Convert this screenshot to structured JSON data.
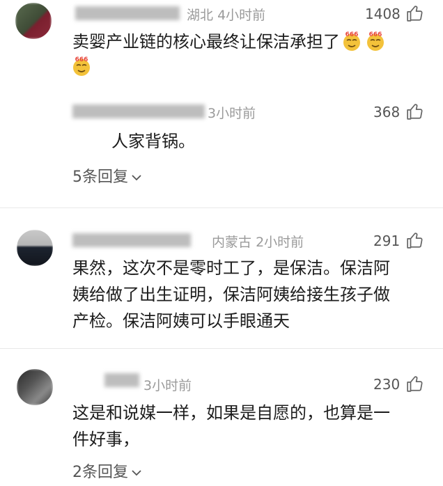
{
  "comments": [
    {
      "location": "湖北",
      "time": "4小时前",
      "likes": "1408",
      "text": "卖婴产业链的核心最终让保洁承担了",
      "emoji_label": "666"
    },
    {
      "time": "3小时前",
      "likes": "368",
      "text": "人家背锅。",
      "replies": "5条回复"
    },
    {
      "location": "内蒙古",
      "time": "2小时前",
      "likes": "291",
      "text_line1": "果然，这次不是零时工了，是保洁。保洁阿",
      "text_line2": "姨给做了出生证明，保洁阿姨给接生孩子做",
      "text_line3": "产检。保洁阿姨可以手眼通天"
    },
    {
      "time": "3小时前",
      "likes": "230",
      "text_line1": "这是和说媒一样，如果是自愿的，也算是一",
      "text_line2": "件好事，",
      "replies": "2条回复"
    }
  ],
  "icons": {
    "like": "thumbs-up-icon",
    "chevron": "chevron-down-icon",
    "emoji": "666-emoji-icon"
  },
  "colors": {
    "meta": "#9a9a9a",
    "text": "#1c1c1c",
    "emoji": "#f3c23a",
    "emoji_badge": "#e8443a"
  }
}
